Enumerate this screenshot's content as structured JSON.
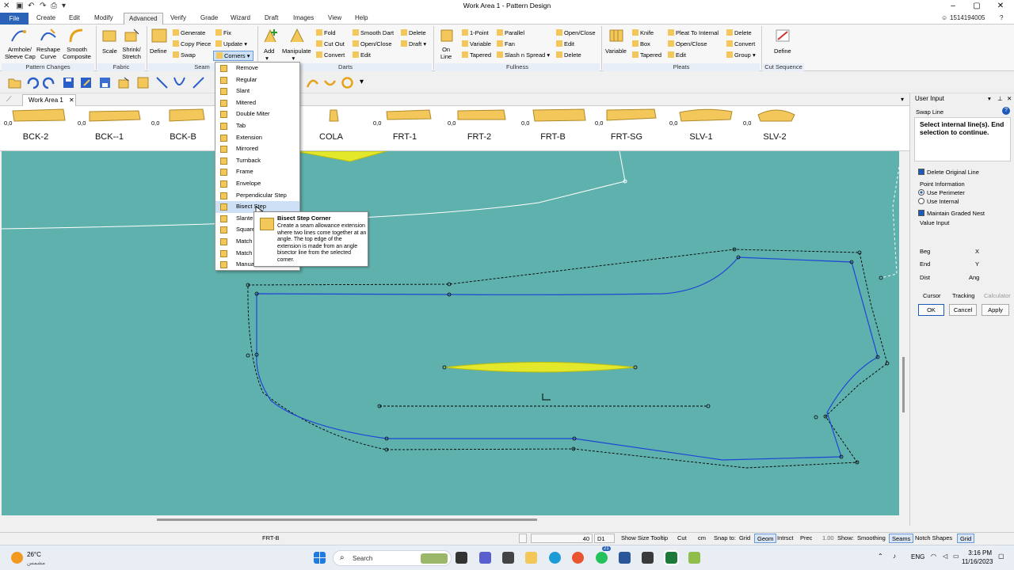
{
  "window": {
    "title": "Work Area 1 - Pattern Design",
    "user_id": "1514194005"
  },
  "menu": [
    "Create",
    "Edit",
    "Modify",
    "Advanced",
    "Verify",
    "Grade",
    "Wizard",
    "Draft",
    "Images",
    "View",
    "Help"
  ],
  "file_label": "File",
  "ribbon": {
    "pattern_changes": {
      "label": "Pattern Changes",
      "items": [
        "Armhole/",
        "Sleeve Cap",
        "Reshape",
        "Curve",
        "Smooth",
        "Composite"
      ]
    },
    "fabric": {
      "label": "Fabric",
      "items": [
        "Scale",
        "Shrink/",
        "Stretch"
      ]
    },
    "seam": {
      "label": "Seam",
      "define": "Define",
      "generate": "Generate",
      "copy_piece": "Copy Piece",
      "swap": "Swap",
      "fix": "Fix",
      "update": "Update",
      "corners": "Corners"
    },
    "darts": {
      "label": "Darts",
      "add": "Add",
      "manipulate": "Manipulate",
      "fold": "Fold",
      "cut_out": "Cut Out",
      "convert": "Convert",
      "smooth_dart": "Smooth Dart",
      "open_close": "Open/Close",
      "edit": "Edit",
      "delete": "Delete",
      "draft": "Draft"
    },
    "fullness": {
      "label": "Fullness",
      "on_line": "On",
      "on_line2": "Line",
      "one_point": "1-Point",
      "variable": "Variable",
      "tapered": "Tapered",
      "parallel": "Parallel",
      "fan": "Fan",
      "slash_spread": "Slash n Spread",
      "open_close": "Open/Close",
      "edit": "Edit",
      "delete": "Delete"
    },
    "pleats": {
      "label": "Pleats",
      "variable": "Variable",
      "knife": "Knife",
      "box": "Box",
      "tapered": "Tapered",
      "pleat_to_internal": "Pleat To Internal",
      "open_close": "Open/Close",
      "edit": "Edit",
      "delete": "Delete",
      "convert": "Convert",
      "group": "Group"
    },
    "cut_sequence": {
      "label": "Cut Sequence",
      "define": "Define"
    }
  },
  "work_tab": "Work Area 1",
  "pieces": [
    {
      "name": "BCK-2",
      "num": "0,0"
    },
    {
      "name": "BCK--1",
      "num": "0,0"
    },
    {
      "name": "BCK-B",
      "num": "0,0"
    },
    {
      "name": "COLA",
      "num": ""
    },
    {
      "name": "FRT-1",
      "num": "0,0"
    },
    {
      "name": "FRT-2",
      "num": "0,0"
    },
    {
      "name": "FRT-B",
      "num": "0,0"
    },
    {
      "name": "FRT-SG",
      "num": "0,0"
    },
    {
      "name": "SLV-1",
      "num": "0,0"
    },
    {
      "name": "SLV-2",
      "num": "0,0"
    }
  ],
  "corners_menu": [
    "Remove",
    "Regular",
    "Slant",
    "Mitered",
    "Double Miter",
    "Tab",
    "Extension",
    "Mirrored",
    "Turnback",
    "Frame",
    "Envelope",
    "Perpendicular Step",
    "Bisect Step",
    "Slante",
    "Square",
    "Match",
    "Match",
    "Manua"
  ],
  "tooltip": {
    "title": "Bisect Step Corner",
    "body": "Create a seam allowance extension where two lines come together at an angle.  The top edge of the extension is made from an angle bisector line from the selected corner."
  },
  "user_input": {
    "header": "User Input",
    "subheader": "Swap Line",
    "instruction": "Select internal line(s). End selection to continue.",
    "delete_original": "Delete Original Line",
    "point_info": "Point Information",
    "use_perimeter": "Use Perimeter",
    "use_internal": "Use Internal",
    "maintain_nest": "Maintain Graded Nest",
    "value_input": "Value Input",
    "beg": "Beg",
    "end": "End",
    "dist": "Dist",
    "x": "X",
    "y": "Y",
    "ang": "Ang",
    "cursor": "Cursor",
    "tracking": "Tracking",
    "calculator": "Calculator",
    "ok": "OK",
    "cancel": "Cancel",
    "apply": "Apply"
  },
  "status": {
    "piece": "FRT-B",
    "zoom": "40",
    "d1": "D1",
    "show_size_tooltip": "Show Size Tooltip",
    "cut": "Cut",
    "cm": "cm",
    "snap_to": "Snap to:",
    "grid": "Grid",
    "geom": "Geom",
    "intrsct": "Intrsct",
    "prec": "Prec",
    "prec_val": "1.00",
    "show": "Show:",
    "smoothing": "Smoothing",
    "seams": "Seams",
    "notch_shapes": "Notch Shapes",
    "grid2": "Grid"
  },
  "taskbar": {
    "temp": "26°C",
    "weather": "مشمس",
    "search": "Search",
    "lang": "ENG",
    "time": "3:16 PM",
    "date": "11/16/2023",
    "badge": "21"
  },
  "colors": {
    "canvas": "#5fb1ad",
    "piece_fill": "#f3c75a",
    "dart_fill": "#e3e82a",
    "seam_line": "#1f45d6",
    "accent": "#2b63b8"
  }
}
